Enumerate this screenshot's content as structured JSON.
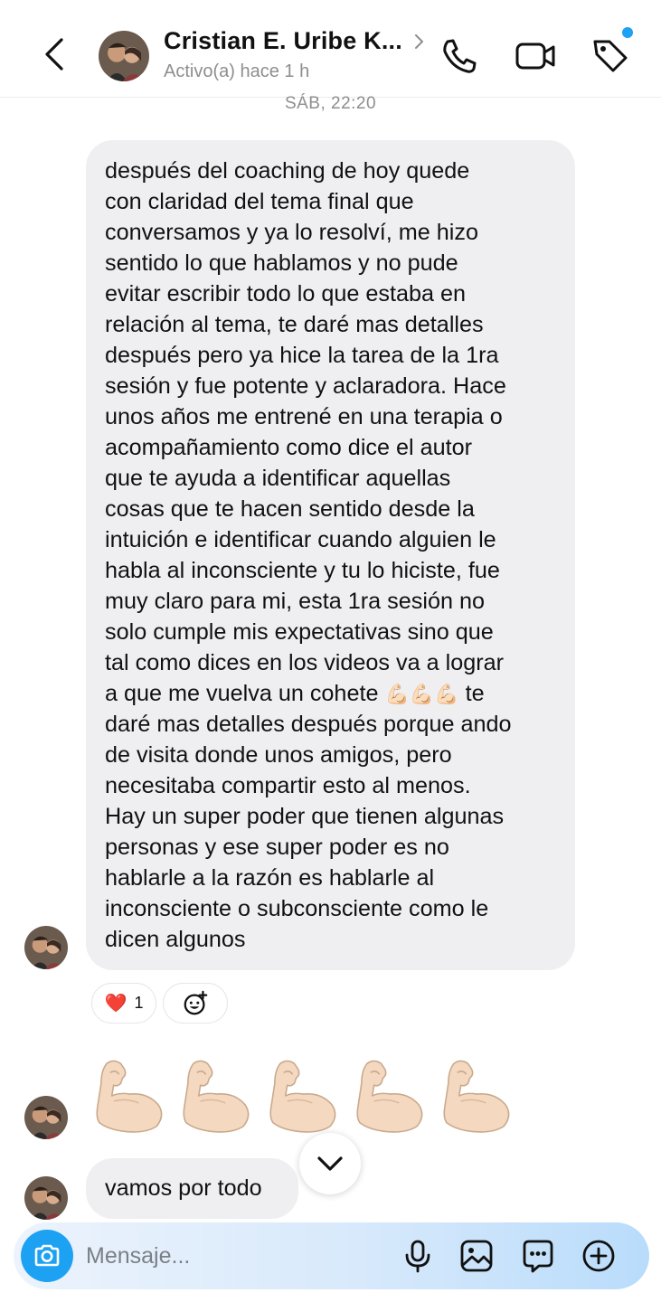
{
  "header": {
    "contact_name": "Cristian E. Uribe K...",
    "status": "Activo(a) hace 1 h"
  },
  "thread": {
    "timestamp": "SÁB, 22:20",
    "message_1": {
      "text_part1": "después del coaching de hoy quede\ncon claridad del tema final que\nconversamos y ya lo resolví, me hizo\nsentido lo que hablamos y no pude\nevitar escribir todo lo que estaba en\nrelación al tema, te daré mas detalles\ndespués pero ya hice la tarea de la 1ra\nsesión y fue potente y aclaradora. Hace\nunos años me entrené en una terapia o\nacompañamiento como dice el autor\nque te ayuda a identificar aquellas\ncosas que te hacen sentido desde la\nintuición e identificar cuando alguien le\nhabla al inconsciente y tu lo hiciste, fue\nmuy claro para mi, esta 1ra sesión no\nsolo cumple mis expectativas sino que\ntal como dices en los videos va a lograr\na que me vuelva un cohete ",
      "inline_emoji": "💪🏻💪🏻💪🏻",
      "text_part2": " te\ndaré mas detalles después porque ando\nde visita donde unos amigos, pero\nnecesitaba compartir esto al menos.\nHay un super poder que tienen algunas\npersonas y ese super poder es no\nhablarle a la razón es hablarle al\ninconsciente o subconsciente como le\ndicen algunos",
      "reaction_emoji": "❤️",
      "reaction_count": "1"
    },
    "message_2": {
      "emoji": "💪🏻💪🏻💪🏻💪🏻💪🏻",
      "count": 5
    },
    "message_3": {
      "text": "vamos por todo"
    }
  },
  "composer": {
    "placeholder": "Mensaje..."
  },
  "icons": [
    "back-icon",
    "chevron-right-icon",
    "phone-icon",
    "video-camera-icon",
    "tag-icon",
    "add-reaction-icon",
    "chevron-down-icon",
    "camera-icon",
    "microphone-icon",
    "gallery-icon",
    "sticker-icon",
    "plus-icon"
  ],
  "colors": {
    "accent": "#1da1f2",
    "bubble": "#efeff2",
    "secondary_text": "#8e8e8e",
    "muscle_skin": "#f4d9c0",
    "heart": "#e4292f"
  }
}
